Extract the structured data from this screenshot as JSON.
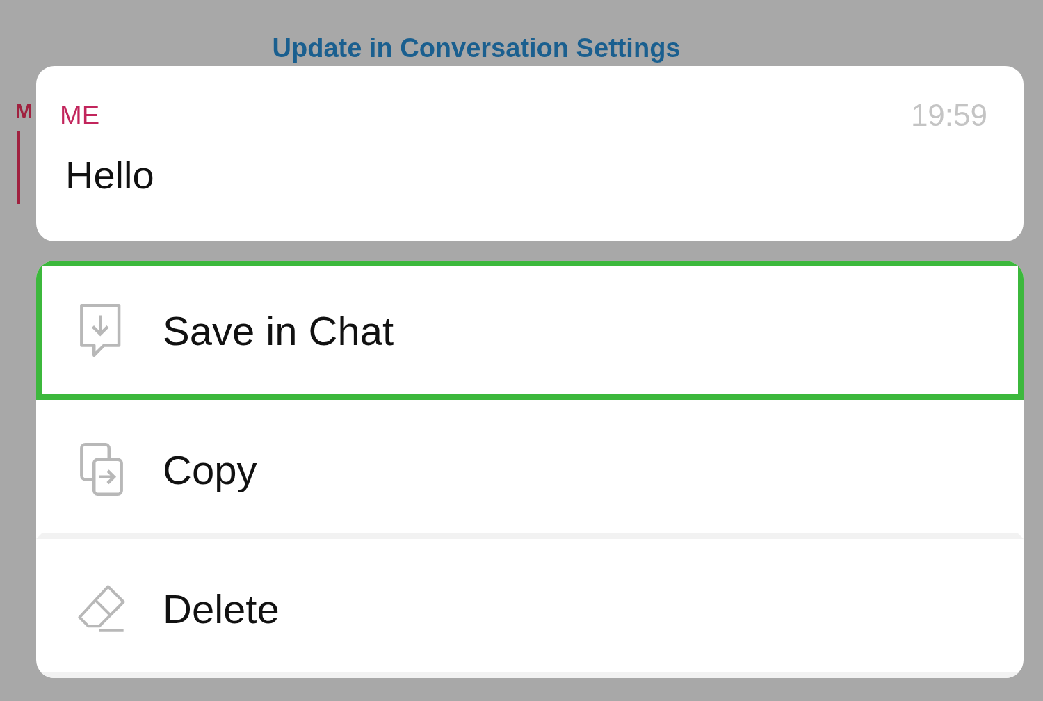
{
  "background": {
    "link": "Update in Conversation Settings",
    "sender_initial": "M"
  },
  "message": {
    "sender": "ME",
    "time": "19:59",
    "text": "Hello"
  },
  "menu": [
    {
      "kind": "save",
      "label": "Save in Chat",
      "highlighted": true
    },
    {
      "kind": "copy",
      "label": "Copy",
      "highlighted": false
    },
    {
      "kind": "delete",
      "label": "Delete",
      "highlighted": false
    }
  ]
}
